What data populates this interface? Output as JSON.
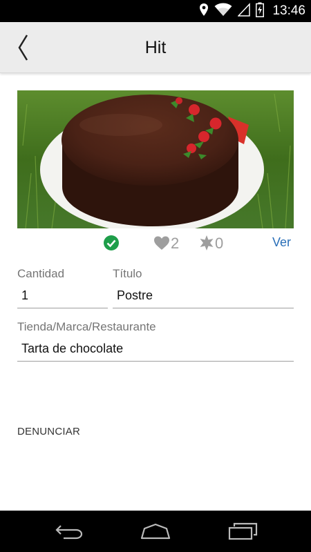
{
  "status_bar": {
    "time": "13:46",
    "icons": [
      "location-icon",
      "wifi-icon",
      "signal-icon",
      "battery-icon"
    ]
  },
  "app_bar": {
    "title": "Hit",
    "back_icon": "chevron-left-icon"
  },
  "photo": {
    "subject": "chocolate-cake-photo"
  },
  "actions": {
    "verified_icon": "check-circle-icon",
    "likes": "2",
    "stars": "0",
    "view_label": "Ver",
    "colors": {
      "verified": "#1e9e4a",
      "link": "#2a6fb8",
      "muted": "#9e9e9e"
    }
  },
  "form": {
    "quantity_label": "Cantidad",
    "quantity_value": "1",
    "title_label": "Título",
    "title_value": "Postre",
    "store_label": "Tienda/Marca/Restaurante",
    "store_value": "Tarta de chocolate"
  },
  "report_label": "DENUNCIAR",
  "nav_bar": {
    "icons": [
      "back-nav-icon",
      "home-nav-icon",
      "recents-nav-icon"
    ]
  }
}
